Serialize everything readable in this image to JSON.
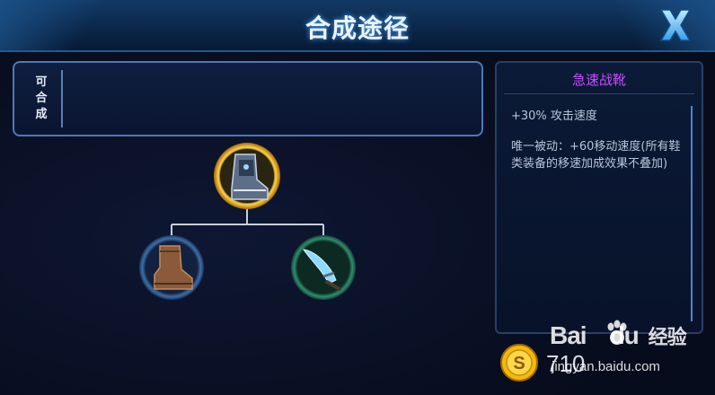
{
  "header": {
    "title": "合成途径",
    "close_icon": "close-x-icon"
  },
  "composable": {
    "label": "可合成"
  },
  "tree": {
    "root": {
      "icon": "swift-boots-icon",
      "selected": true
    },
    "children": [
      {
        "icon": "leather-boots-icon"
      },
      {
        "icon": "dagger-icon"
      }
    ]
  },
  "info": {
    "item_name": "急速战靴",
    "stat": "+30% 攻击速度",
    "passive": "唯一被动：+60移动速度(所有鞋类装备的移速加成效果不叠加)"
  },
  "price": {
    "icon": "gold-coin-icon",
    "value": "710"
  },
  "watermark": {
    "brand": "Bai",
    "brand_suffix": "du",
    "brand_cn": "经验",
    "url": "jingyan.baidu.com"
  },
  "colors": {
    "item_name": "#c94dff",
    "accent_blue": "#4fa8ff",
    "gold": "#f2b90f"
  }
}
